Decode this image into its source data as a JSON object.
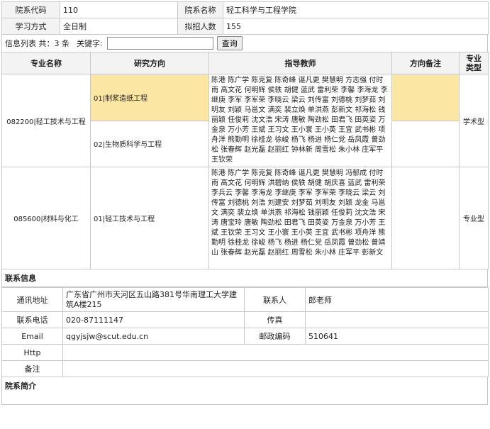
{
  "college": {
    "code_label": "院系代码",
    "code": "110",
    "name_label": "院系名称",
    "name": "轻工科学与工程学院",
    "mode_label": "学习方式",
    "mode": "全日制",
    "count_label": "拟招人数",
    "count": "155"
  },
  "search": {
    "info_label": "信息列表 共：3 条",
    "keyword_label": "关键字:",
    "keyword_value": "",
    "button_label": "查询"
  },
  "table": {
    "headers": [
      "专业名称",
      "研究方向",
      "指导教师",
      "方向备注",
      "专业类型"
    ],
    "majors": [
      {
        "name": "082200|轻工技术与工程",
        "type": "学术型",
        "directions": [
          {
            "name": "01|制浆造纸工程",
            "note": ""
          },
          {
            "name": "02|生物质科学与工程",
            "note": ""
          }
        ],
        "teachers": "陈港 陈广学 陈克复 陈奇峰 谌凡更 樊慧明 方志强 付时雨 高文花 何明辉 侯轶 胡健 蓝武 雷利荣 李馨 李海龙 李继庚 李军 李军荣 李晓云 梁云 刘传富 刘德桃 刘梦茹 刘明友 刘颖 马邕文 满奕 裴立焕 单洪燕 彭新文 祁海松 钱丽颖 任俊莉 沈文浩 宋涛 唐敏 陶劲松 田君飞 田英姿 万金泉 万小芳 王斌 王习文 王小寰 王小英 王宜 武书彬 项舟洋 熊勤明 徐桂龙 徐峻 杨飞 杨进 杨仁党 岳凤霞 曾劲松 张春辉 赵光磊 赵丽红 钟林新 周雪松 朱小林 庄军平 王钦荣"
      },
      {
        "name": "085600|材料与化工",
        "type": "专业型",
        "directions": [
          {
            "name": "01|轻工技术与工程",
            "note": ""
          }
        ],
        "teachers": "陈港 陈广学 陈克复 陈奇峰 谌凡更 樊慧明 冯郁成 付时雨 高文花 何明辉 洪碧纳 侯轶 胡健 胡庆喜 蓝武 雷利荣 李兵云 李馨 李海龙 李继庚 李军 李军荣 李晓云 梁云 刘传富 刘德桃 刘浩 刘建安 刘梦茹 刘明友 刘颖 龙金 马邕文 满奕 裴立焕 单洪燕 祁海松 钱丽颖 任俊莉 沈文浩 宋涛 唐宝玲 唐敏 陶劲松 田君飞 田英姿 万金泉 万小芳 王斌 王钦荣 王习文 王小寰 王小英 王宜 武书彬 项舟洋 熊勤明 徐桂龙 徐峻 杨飞 杨进 杨仁党 岳凤霞 曾劲松 曾靖山 张春辉 赵光磊 赵丽红 周雪松 朱小林 庄军平 彭新文"
      }
    ]
  },
  "contact": {
    "section_title": "联系信息",
    "address_label": "通讯地址",
    "address": "广东省广州市天河区五山路381号华南理工大学建筑A楼215",
    "person_label": "联系人",
    "person": "郎老师",
    "phone_label": "联系电话",
    "phone": "020-87111147",
    "fax_label": "传真",
    "fax": "",
    "email_label": "Email",
    "email": "qgyjsjw@scut.edu.cn",
    "postcode_label": "邮政编码",
    "postcode": "510641",
    "http_label": "Http",
    "http": "",
    "remark_label": "备注",
    "remark": ""
  },
  "intro": {
    "section_title": "院系简介"
  }
}
